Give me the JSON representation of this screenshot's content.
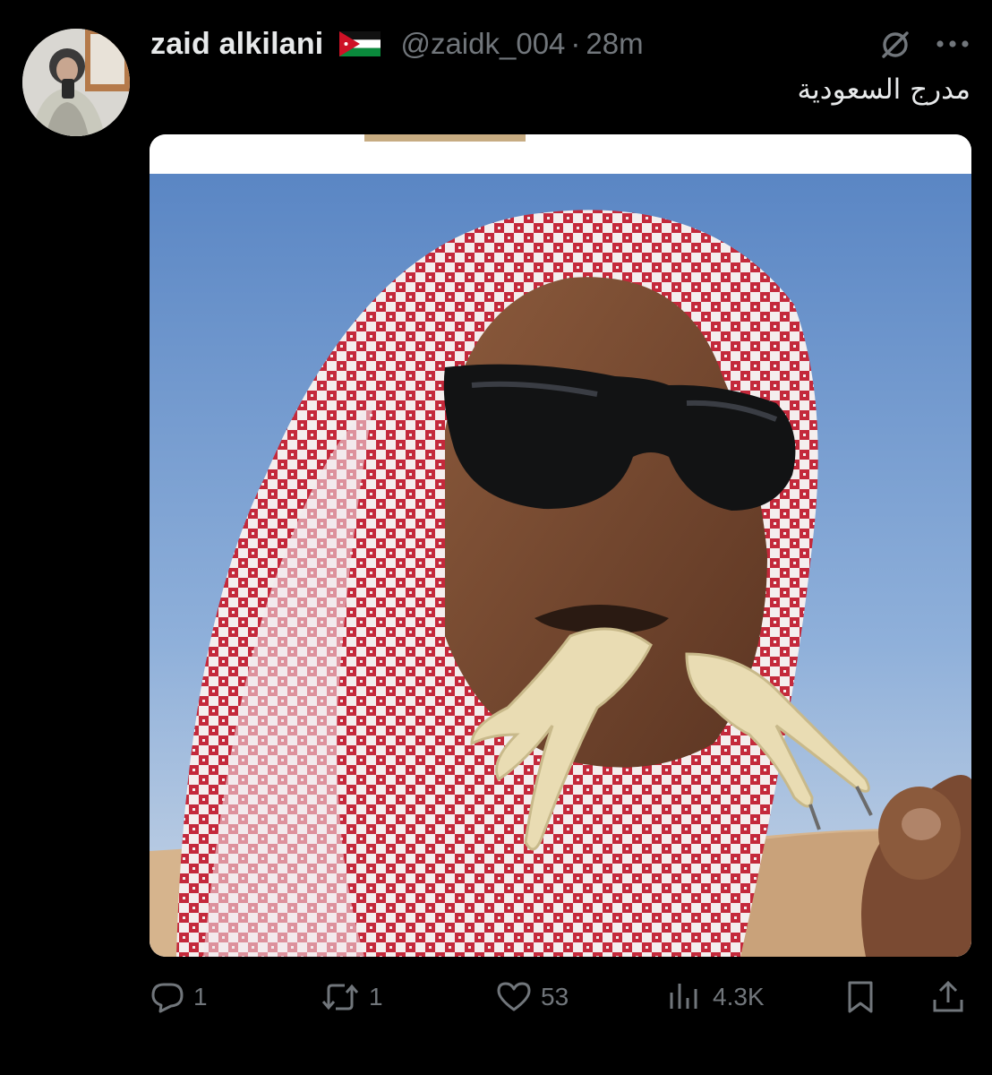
{
  "author": {
    "display_name": "zaid alkilani",
    "flag": "jordan-flag",
    "handle": "@zaidk_004",
    "separator": "·",
    "time": "28m"
  },
  "tweet": {
    "text": "مدرج السعودية"
  },
  "media": {
    "type": "photo"
  },
  "actions": {
    "replies": "1",
    "reposts": "1",
    "likes": "53",
    "views": "4.3K"
  },
  "colors": {
    "background": "#000000",
    "text": "#e7e9ea",
    "muted": "#71767b"
  },
  "icons": {
    "reply": "speech-bubble-icon",
    "repost": "repost-arrows-icon",
    "like": "heart-icon",
    "views": "bar-chart-icon",
    "bookmark": "bookmark-icon",
    "share": "share-upload-icon",
    "grok": "grok-icon",
    "more": "more-dots-icon"
  }
}
